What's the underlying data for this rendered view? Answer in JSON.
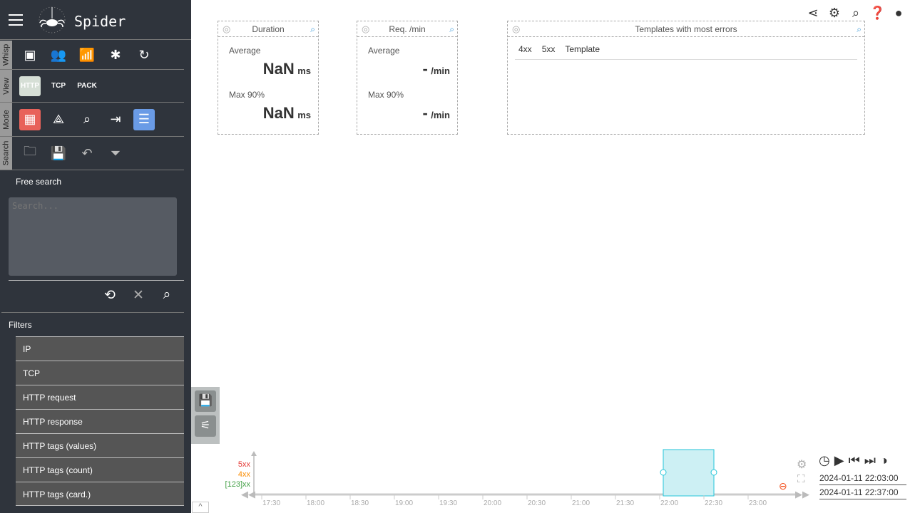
{
  "app": {
    "title": "Spider"
  },
  "sidebar": {
    "tabs": [
      "Whisp",
      "View",
      "Mode",
      "Search"
    ],
    "view_buttons": [
      "HTTP",
      "TCP",
      "PACK"
    ],
    "free_search_label": "Free search",
    "search_placeholder": "Search...",
    "filters_title": "Filters",
    "filters": [
      "IP",
      "TCP",
      "HTTP request",
      "HTTP response",
      "HTTP tags (values)",
      "HTTP tags (count)",
      "HTTP tags (card.)"
    ]
  },
  "panels": {
    "duration": {
      "title": "Duration",
      "avg_label": "Average",
      "avg_value": "NaN",
      "avg_unit": "ms",
      "max_label": "Max 90%",
      "max_value": "NaN",
      "max_unit": "ms"
    },
    "requests": {
      "title": "Req. /min",
      "avg_label": "Average",
      "avg_value": "-",
      "avg_unit": "/min",
      "max_label": "Max 90%",
      "max_value": "-",
      "max_unit": "/min"
    },
    "errors": {
      "title": "Templates with most errors",
      "columns": [
        "4xx",
        "5xx",
        "Template"
      ]
    }
  },
  "timeline": {
    "legend": [
      {
        "label": "5xx",
        "color": "#e53935"
      },
      {
        "label": "4xx",
        "color": "#fb8c00"
      },
      {
        "label": "[123]xx",
        "color": "#43a047"
      }
    ],
    "ticks": [
      "17:30",
      "18:00",
      "18:30",
      "19:00",
      "19:30",
      "20:00",
      "20:30",
      "21:00",
      "21:30",
      "22:00",
      "22:30",
      "23:00"
    ],
    "start": "2024-01-11 22:03:00",
    "end": "2024-01-11 22:37:00",
    "selection_color": "#26c6da"
  }
}
